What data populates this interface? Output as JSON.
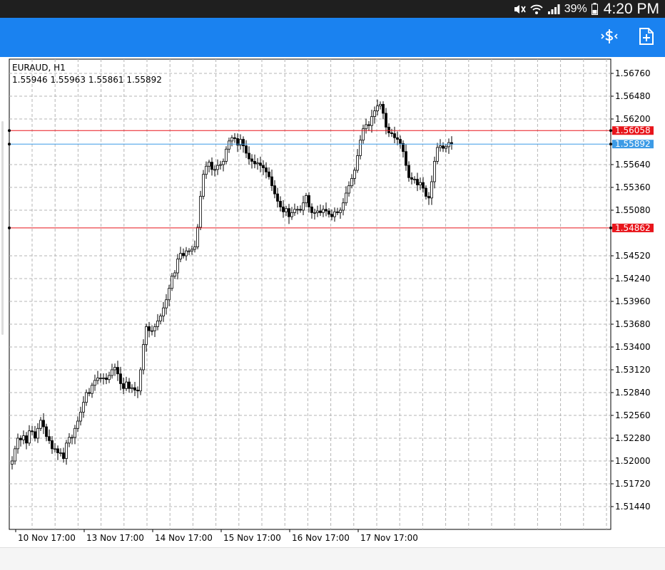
{
  "status_bar": {
    "battery_percent": "39%",
    "time": "4:20 PM",
    "icons": [
      "mute-icon",
      "wifi-icon",
      "signal-icon",
      "battery-icon"
    ]
  },
  "app_bar": {
    "background": "#1a82f0",
    "actions": [
      {
        "name": "trade-icon",
        "label": "trade"
      },
      {
        "name": "new-order-icon",
        "label": "new order"
      }
    ]
  },
  "chart": {
    "symbol": "EURAUD, H1",
    "ohlc": "1.55946 1.55963 1.55861 1.55892"
  },
  "chart_data": {
    "type": "candlestick",
    "title": "EURAUD, H1",
    "ylim": [
      1.5116,
      1.56935
    ],
    "y_ticks": [
      "1.56760",
      "1.56480",
      "1.56200",
      "1.55640",
      "1.55360",
      "1.55080",
      "1.54520",
      "1.54240",
      "1.53960",
      "1.53680",
      "1.53400",
      "1.53120",
      "1.52840",
      "1.52560",
      "1.52280",
      "1.52000",
      "1.51720",
      "1.51440"
    ],
    "x_labels": [
      "10 Nov 17:00",
      "13 Nov 17:00",
      "14 Nov 17:00",
      "15 Nov 17:00",
      "16 Nov 17:00",
      "17 Nov 17:00"
    ],
    "horizontal_lines": [
      {
        "price": 1.56058,
        "label": "1.56058",
        "color": "#e8151b"
      },
      {
        "price": 1.55892,
        "label": "1.55892",
        "color": "#3d9be6"
      },
      {
        "price": 1.54862,
        "label": "1.54862",
        "color": "#e8151b"
      }
    ],
    "candle_count": 146,
    "close_series": [
      1.52,
      1.5215,
      1.5228,
      1.5226,
      1.5231,
      1.5222,
      1.5237,
      1.5236,
      1.5228,
      1.524,
      1.525,
      1.5242,
      1.523,
      1.5225,
      1.5215,
      1.5215,
      1.521,
      1.521,
      1.5203,
      1.5222,
      1.5229,
      1.5229,
      1.524,
      1.5249,
      1.526,
      1.5272,
      1.5284,
      1.5283,
      1.5293,
      1.5299,
      1.5302,
      1.5302,
      1.5302,
      1.53,
      1.5305,
      1.5312,
      1.5315,
      1.5307,
      1.5295,
      1.5289,
      1.5297,
      1.5289,
      1.529,
      1.5287,
      1.5286,
      1.5312,
      1.5343,
      1.5365,
      1.536,
      1.536,
      1.5365,
      1.5372,
      1.5378,
      1.5388,
      1.5398,
      1.5412,
      1.5427,
      1.5431,
      1.5448,
      1.5455,
      1.5452,
      1.5458,
      1.5458,
      1.546,
      1.5463,
      1.5487,
      1.5525,
      1.5552,
      1.5562,
      1.5567,
      1.5558,
      1.5558,
      1.5563,
      1.5564,
      1.5568,
      1.5583,
      1.5593,
      1.5597,
      1.5596,
      1.5588,
      1.5595,
      1.5587,
      1.5578,
      1.5571,
      1.5568,
      1.5565,
      1.5566,
      1.5563,
      1.556,
      1.5555,
      1.5549,
      1.5538,
      1.5528,
      1.5519,
      1.5512,
      1.5506,
      1.551,
      1.55,
      1.5505,
      1.5509,
      1.5509,
      1.5508,
      1.5517,
      1.5526,
      1.5512,
      1.5505,
      1.5505,
      1.5507,
      1.5505,
      1.5509,
      1.5507,
      1.5503,
      1.55,
      1.5506,
      1.5505,
      1.5508,
      1.5517,
      1.5529,
      1.5538,
      1.5547,
      1.5557,
      1.5575,
      1.5594,
      1.5608,
      1.5613,
      1.5612,
      1.5623,
      1.563,
      1.5636,
      1.5638,
      1.5627,
      1.561,
      1.5603,
      1.5602,
      1.5597,
      1.5595,
      1.559,
      1.558,
      1.5563,
      1.5548,
      1.5546,
      1.5546,
      1.5539,
      1.5542,
      1.5535,
      1.5525,
      1.5523,
      1.5543,
      1.5568,
      1.5585,
      1.5587,
      1.5584,
      1.5586,
      1.5591,
      1.5589
    ],
    "grid": true
  }
}
